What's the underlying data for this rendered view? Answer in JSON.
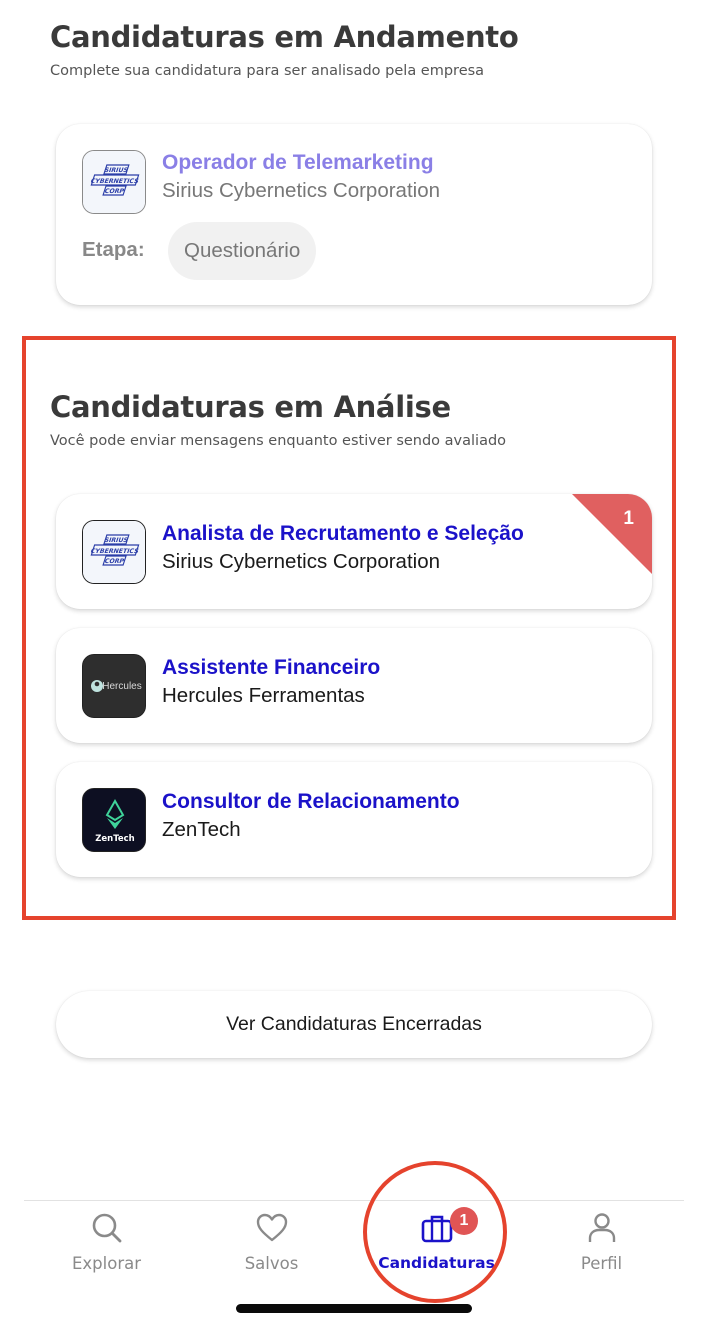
{
  "in_progress": {
    "title": "Candidaturas em Andamento",
    "subtitle": "Complete sua candidatura para ser analisado pela empresa",
    "cards": [
      {
        "job_title": "Operador de Telemarketing",
        "company": "Sirius Cybernetics Corporation",
        "logo_text": [
          "SIRIUS",
          "CYBERNETICS",
          "CORP"
        ],
        "stage_label": "Etapa:",
        "stage_value": "Questionário"
      }
    ]
  },
  "in_review": {
    "title": "Candidaturas em Análise",
    "subtitle": "Você pode enviar mensagens enquanto estiver sendo avaliado",
    "cards": [
      {
        "job_title": "Analista de Recrutamento e Seleção",
        "company": "Sirius Cybernetics Corporation",
        "logo_text": [
          "SIRIUS",
          "CYBERNETICS",
          "CORP"
        ],
        "notification_count": "1"
      },
      {
        "job_title": "Assistente Financeiro",
        "company": "Hercules Ferramentas",
        "logo_text": "Hercules"
      },
      {
        "job_title": "Consultor de Relacionamento",
        "company": "ZenTech",
        "logo_text": "ZenTech"
      }
    ]
  },
  "closed_button": "Ver Candidaturas Encerradas",
  "tabbar": {
    "tabs": [
      {
        "label": "Explorar",
        "icon": "search-icon"
      },
      {
        "label": "Salvos",
        "icon": "heart-icon"
      },
      {
        "label": "Candidaturas",
        "icon": "briefcase-icon",
        "active": true,
        "badge": "1"
      },
      {
        "label": "Perfil",
        "icon": "user-icon"
      }
    ]
  },
  "colors": {
    "accent": "#1b12c9",
    "pending_title": "#8a7fe6",
    "highlight": "#e5432d",
    "badge": "#e05555"
  }
}
